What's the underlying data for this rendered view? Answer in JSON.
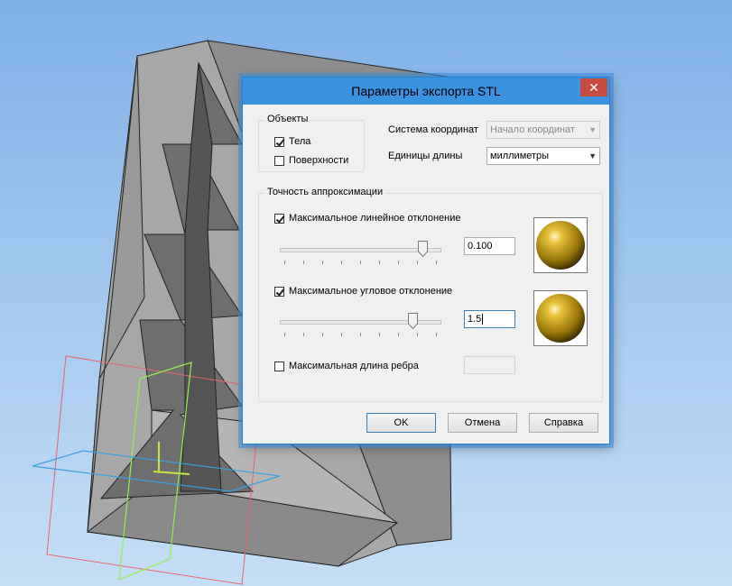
{
  "dialog": {
    "title": "Параметры экспорта STL",
    "close_glyph": "✕"
  },
  "objects": {
    "legend": "Объекты",
    "bodies": {
      "label": "Тела",
      "checked": true
    },
    "surfaces": {
      "label": "Поверхности",
      "checked": false
    }
  },
  "coords": {
    "label": "Система координат",
    "value": "Начало координат",
    "enabled": false
  },
  "units": {
    "label": "Единицы длины",
    "value": "миллиметры"
  },
  "accuracy": {
    "legend": "Точность аппроксимации",
    "linear": {
      "label": "Максимальное линейное отклонение",
      "checked": true,
      "value": "0.100",
      "slider_fraction": 0.87
    },
    "angular": {
      "label": "Максимальное угловое отклонение",
      "checked": true,
      "value": "1.5",
      "slider_fraction": 0.8
    },
    "edge": {
      "label": "Максимальная длина ребра",
      "checked": false,
      "value": ""
    }
  },
  "buttons": {
    "ok": "OK",
    "cancel": "Отмена",
    "help": "Справка"
  },
  "colors": {
    "titlebar": "#3b92df",
    "close": "#c74a3f",
    "sphere": "#b8900a"
  }
}
